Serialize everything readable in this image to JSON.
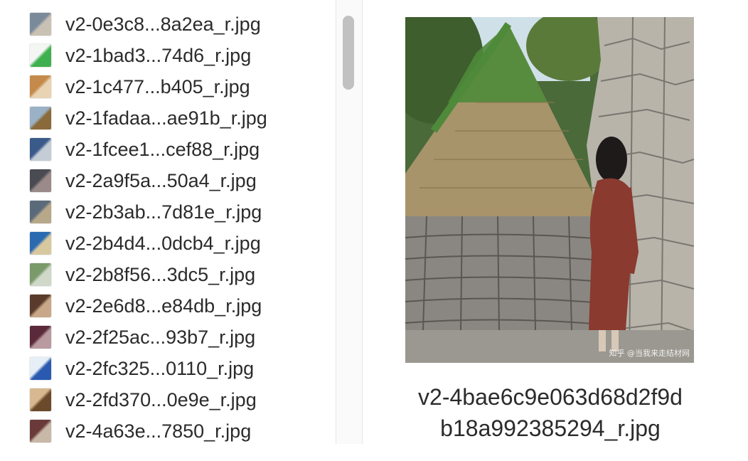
{
  "file_list": {
    "items": [
      {
        "name": "v2-0e3c8...8a2ea_r.jpg",
        "thumb_colors": [
          "#7a8a9a",
          "#c9c2b4"
        ]
      },
      {
        "name": "v2-1bad3...74d6_r.jpg",
        "thumb_colors": [
          "#f4f6f4",
          "#3fb04f"
        ]
      },
      {
        "name": "v2-1c477...b405_r.jpg",
        "thumb_colors": [
          "#c58a4a",
          "#e8d3b2"
        ]
      },
      {
        "name": "v2-1fadaa...ae91b_r.jpg",
        "thumb_colors": [
          "#9ab1c6",
          "#8a6a3a"
        ]
      },
      {
        "name": "v2-1fcee1...cef88_r.jpg",
        "thumb_colors": [
          "#3a5a8a",
          "#c4ccd6"
        ]
      },
      {
        "name": "v2-2a9f5a...50a4_r.jpg",
        "thumb_colors": [
          "#4a4a52",
          "#9a8a8a"
        ]
      },
      {
        "name": "v2-2b3ab...7d81e_r.jpg",
        "thumb_colors": [
          "#5a6a7a",
          "#b8a88a"
        ]
      },
      {
        "name": "v2-2b4d4...0dcb4_r.jpg",
        "thumb_colors": [
          "#2a6ab0",
          "#d8c8a0"
        ]
      },
      {
        "name": "v2-2b8f56...3dc5_r.jpg",
        "thumb_colors": [
          "#7a9a6a",
          "#d0d8c8"
        ]
      },
      {
        "name": "v2-2e6d8...e84db_r.jpg",
        "thumb_colors": [
          "#5a3a2a",
          "#c8a888"
        ]
      },
      {
        "name": "v2-2f25ac...93b7_r.jpg",
        "thumb_colors": [
          "#5a2a3a",
          "#b89aa0"
        ]
      },
      {
        "name": "v2-2fc325...0110_r.jpg",
        "thumb_colors": [
          "#e6eef6",
          "#2a5ab0"
        ]
      },
      {
        "name": "v2-2fd370...0e9e_r.jpg",
        "thumb_colors": [
          "#d8b890",
          "#6a4a2a"
        ]
      },
      {
        "name": "v2-4a63e...7850_r.jpg",
        "thumb_colors": [
          "#6a3a3a",
          "#c8b8a8"
        ]
      }
    ]
  },
  "preview": {
    "caption_line1": "v2-4bae6c9e063d68d2f9d",
    "caption_line2": "b18a992385294_r.jpg",
    "watermark": "知乎 @当我来走结材网"
  }
}
